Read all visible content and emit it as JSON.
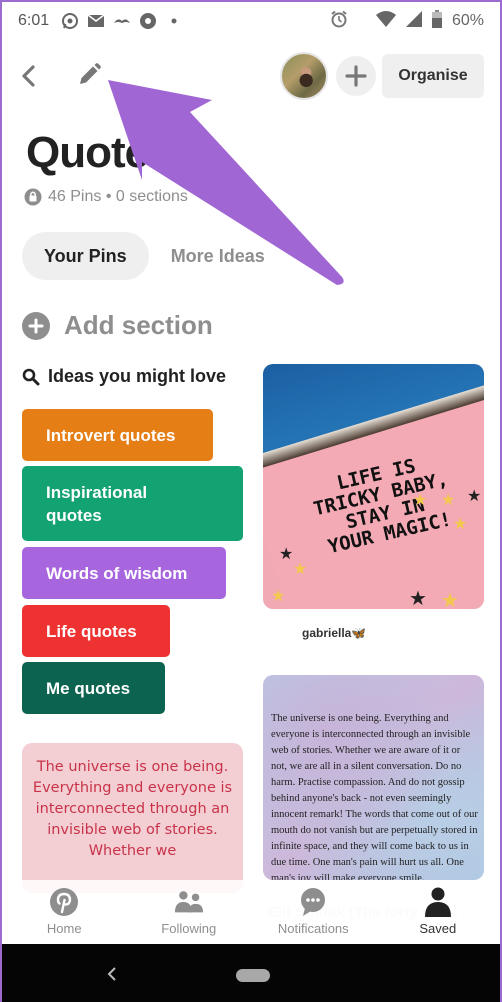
{
  "status_bar": {
    "time": "6:01",
    "left_icons": [
      "whatsapp-icon",
      "mail-icon",
      "mustache-icon",
      "aperture-icon",
      "dot-icon"
    ],
    "right_icons": [
      "alarm-icon",
      "wifi-icon",
      "signal-icon",
      "battery-icon"
    ],
    "battery": "60%"
  },
  "topbar": {
    "back_icon": "chevron-left-icon",
    "edit_icon": "pencil-icon",
    "avatar_alt": "profile-avatar",
    "add_icon": "plus-icon",
    "organise_label": "Organise"
  },
  "board": {
    "title": "Quotes",
    "secret_icon": "lock-icon",
    "meta": "46 Pins • 0 sections"
  },
  "tabs": [
    {
      "label": "Your Pins",
      "active": true
    },
    {
      "label": "More Ideas",
      "active": false
    }
  ],
  "add_section": {
    "label": "Add section"
  },
  "ideas": {
    "heading": "Ideas you might love",
    "chips": [
      {
        "label": "Introvert quotes",
        "color": "#E67E16"
      },
      {
        "label": "Inspirational quotes",
        "color": "#13A272"
      },
      {
        "label": "Words of wisdom",
        "color": "#A766DE"
      },
      {
        "label": "Life quotes",
        "color": "#EE3232"
      },
      {
        "label": "Me quotes",
        "color": "#0C634F"
      }
    ]
  },
  "pins": [
    {
      "image_text": [
        "LIFE IS",
        "TRICKY BABY,",
        "STAY IN",
        "YOUR MAGIC!"
      ],
      "caption": "gabriella🦋"
    },
    {
      "image_text": "The universe is one being. Everything and everyone is interconnected through an invisible web of stories. Whether we are aware of it or not, we are all in a silent conversation. Do no harm. Practise compassion. And do not gossip behind anyone's back - not even seemingly innocent remark! The words that come out of our mouth do not vanish but are perpetually stored in infinite space, and they will come back to us in due time. One man's pain will hurt us all. One man's joy will make everyone smile.",
      "caption": "Elif Shafak (The forty rules"
    },
    {
      "image_text": "The universe is one being. Everything and everyone is interconnected through an invisible web of stories. Whether we"
    }
  ],
  "bottom_nav": [
    {
      "label": "Home",
      "icon": "pinterest-icon",
      "active": false
    },
    {
      "label": "Following",
      "icon": "people-icon",
      "active": false
    },
    {
      "label": "Notifications",
      "icon": "chat-bubble-icon",
      "active": false
    },
    {
      "label": "Saved",
      "icon": "person-icon",
      "active": true
    }
  ],
  "annotation": {
    "color": "#A066D3"
  }
}
